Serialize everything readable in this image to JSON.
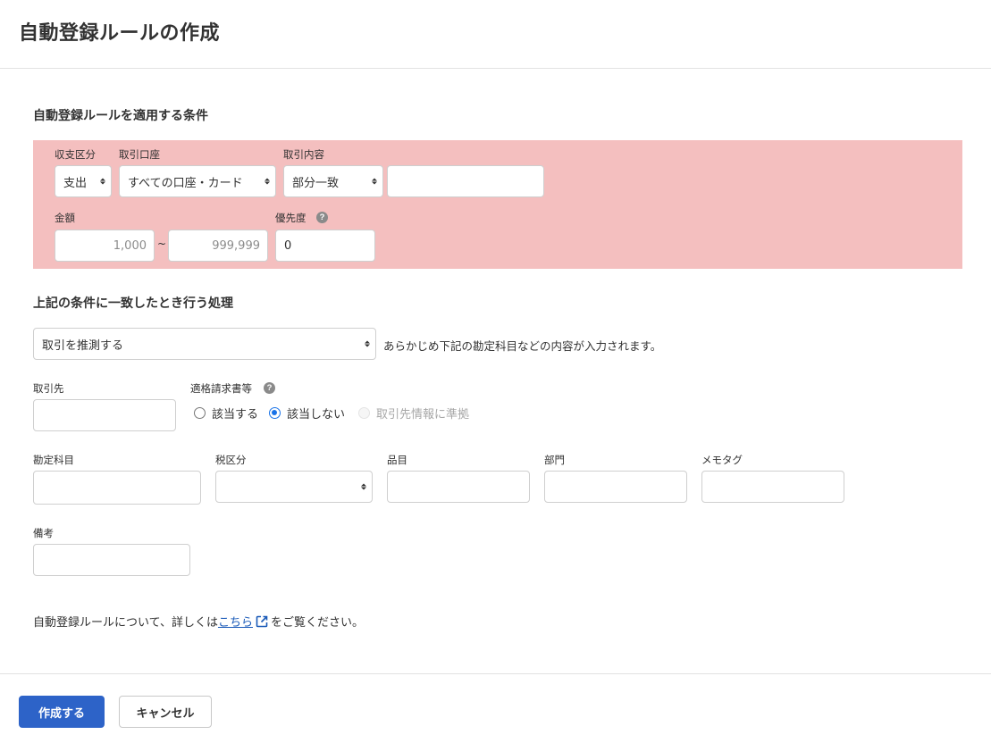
{
  "page": {
    "title": "自動登録ルールの作成"
  },
  "conditions": {
    "section_title": "自動登録ルールを適用する条件",
    "income_type": {
      "label": "収支区分",
      "value": "支出"
    },
    "account": {
      "label": "取引口座",
      "value": "すべての口座・カード"
    },
    "description": {
      "label": "取引内容",
      "match_value": "部分一致",
      "text_value": ""
    },
    "amount": {
      "label": "金額",
      "min": "1,000",
      "separator": "~",
      "max": "999,999"
    },
    "priority": {
      "label": "優先度",
      "value": "0",
      "help": "?"
    }
  },
  "actions": {
    "section_title": "上記の条件に一致したとき行う処理",
    "action_select": {
      "value": "取引を推測する"
    },
    "hint": "あらかじめ下記の勘定科目などの内容が入力されます。",
    "partner": {
      "label": "取引先",
      "value": ""
    },
    "invoice": {
      "label": "適格請求書等",
      "help": "?",
      "options": [
        "該当する",
        "該当しない",
        "取引先情報に準拠"
      ],
      "selected": "該当しない"
    },
    "account_item": {
      "label": "勘定科目",
      "value": ""
    },
    "tax": {
      "label": "税区分",
      "value": ""
    },
    "item": {
      "label": "品目",
      "value": ""
    },
    "section": {
      "label": "部門",
      "value": ""
    },
    "memo_tag": {
      "label": "メモタグ",
      "value": ""
    },
    "remarks": {
      "label": "備考",
      "value": ""
    }
  },
  "footnote": {
    "before": "自動登録ルールについて、詳しくは",
    "link": "こちら",
    "after": "をご覧ください。"
  },
  "buttons": {
    "create": "作成する",
    "cancel": "キャンセル"
  },
  "colors": {
    "condition_bg": "#f4bfbf",
    "primary": "#2d63c8",
    "link": "#1a5ab8",
    "radio_accent": "#1a73e8"
  }
}
